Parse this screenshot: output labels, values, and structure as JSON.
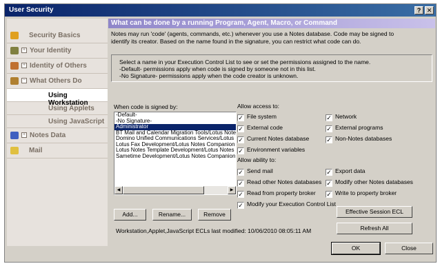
{
  "window": {
    "title": "User Security",
    "help_glyph": "?",
    "close_glyph": "✕"
  },
  "nav": {
    "items": [
      {
        "label": "Security Basics",
        "expander": "",
        "icon": "key-icon"
      },
      {
        "label": "Your Identity",
        "expander": "+",
        "icon": "id-card-icon"
      },
      {
        "label": "Identity of Others",
        "expander": "+",
        "icon": "people-icon"
      },
      {
        "label": "What Others Do",
        "expander": "−",
        "icon": "people-gear-icon"
      }
    ],
    "sub_items": [
      {
        "label": "Using Workstation",
        "active": true
      },
      {
        "label": "Using Applets",
        "active": false
      },
      {
        "label": "Using JavaScript",
        "active": false
      }
    ],
    "items2": [
      {
        "label": "Notes Data",
        "expander": "+",
        "icon": "database-icon"
      },
      {
        "label": "Mail",
        "expander": "",
        "icon": "mail-icon"
      }
    ]
  },
  "content": {
    "header": "What can be done by a running Program, Agent, Macro, or Command",
    "desc_line1": "Notes may run 'code' (agents, commands, etc.) whenever you use a Notes database. Code may be signed to",
    "desc_line2": "identify its creator. Based on the name found in the signature, you can restrict what code can do.",
    "info_line1": "Select a name in your Execution Control List to see or set the permissions assigned to the name.",
    "info_line2": "-Default- permissions apply when code is signed by someone not in this list.",
    "info_line3": "-No Signature- permissions apply when the code creator is unknown.",
    "signed_by_label": "When code is signed by:",
    "signers": [
      "-Default-",
      "-No Signature-",
      "Administrator",
      "BT Mail and Calendar Migration Tools/Lotus Notes",
      "Domino Unified Communications Services/Lotus Notes",
      "Lotus Fax Development/Lotus Notes Companion Products",
      "Lotus Notes Template Development/Lotus Notes",
      "Sametime Development/Lotus Notes Companion Products"
    ],
    "selected_signer": "Administrator",
    "allow_access_label": "Allow access to:",
    "access": [
      {
        "label": "File system",
        "checked": true
      },
      {
        "label": "Network",
        "checked": true
      },
      {
        "label": "External code",
        "checked": true
      },
      {
        "label": "External programs",
        "checked": true
      },
      {
        "label": "Current Notes database",
        "checked": true
      },
      {
        "label": "Non-Notes databases",
        "checked": true
      },
      {
        "label": "Environment variables",
        "checked": true
      }
    ],
    "allow_ability_label": "Allow ability to:",
    "ability": [
      {
        "label": "Send mail",
        "checked": true
      },
      {
        "label": "Export data",
        "checked": true
      },
      {
        "label": "Read other Notes databases",
        "checked": true
      },
      {
        "label": "Modify other Notes databases",
        "checked": true
      },
      {
        "label": "Read from property broker",
        "checked": true
      },
      {
        "label": "Write to property broker",
        "checked": true
      },
      {
        "label": "Modify your Execution Control List",
        "checked": true
      }
    ],
    "buttons": {
      "add": "Add...",
      "rename": "Rename...",
      "remove": "Remove",
      "effective_ecl": "Effective Session ECL",
      "refresh_all": "Refresh All"
    },
    "last_modified": "Workstation,Applet,JavaScript ECLs last modified:  10/06/2010 08:05:11 AM"
  },
  "footer": {
    "ok": "OK",
    "close": "Close"
  },
  "check_glyph": "✓",
  "arrow_left": "◀",
  "arrow_right": "▶"
}
